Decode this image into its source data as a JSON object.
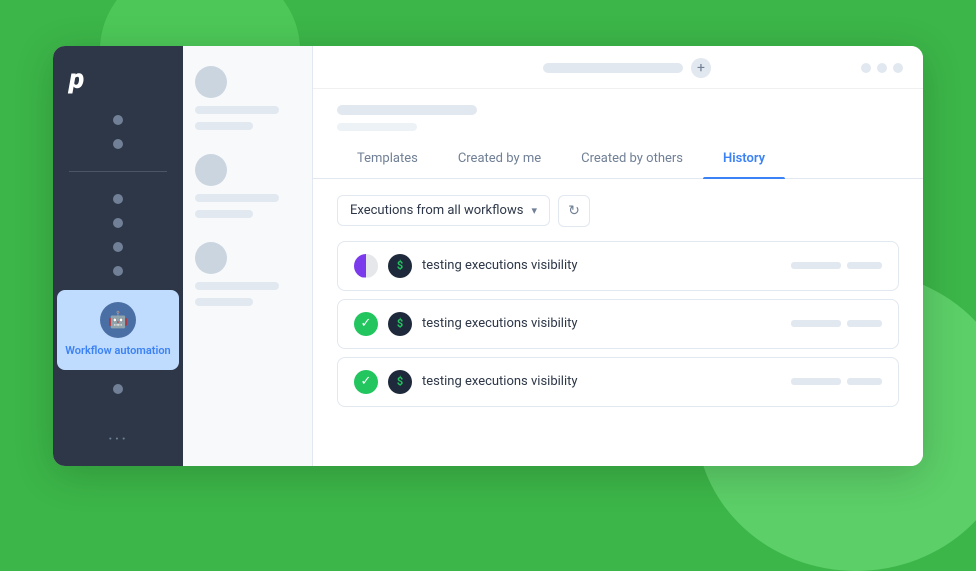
{
  "app": {
    "logo": "p",
    "window_controls": [
      "dot1",
      "dot2",
      "dot3"
    ]
  },
  "sidebar": {
    "nav_items": [
      {
        "id": "dot1",
        "active": false
      },
      {
        "id": "dot2",
        "active": false
      },
      {
        "id": "dot3",
        "active": false
      },
      {
        "id": "dot4",
        "active": false
      },
      {
        "id": "dot5",
        "active": false
      },
      {
        "id": "dot6",
        "active": false
      },
      {
        "id": "dot7",
        "active": false
      }
    ],
    "active_item": {
      "label": "Workflow\nautomation",
      "icon": "🤖"
    },
    "more_label": "···"
  },
  "tabs": [
    {
      "id": "templates",
      "label": "Templates",
      "active": false
    },
    {
      "id": "created-by-me",
      "label": "Created by me",
      "active": false
    },
    {
      "id": "created-by-others",
      "label": "Created by others",
      "active": false
    },
    {
      "id": "history",
      "label": "History",
      "active": true
    }
  ],
  "dropdown": {
    "value": "Executions from all workflows",
    "placeholder": "Executions from all workflows"
  },
  "refresh_button": {
    "icon": "↻"
  },
  "executions": [
    {
      "id": 1,
      "status": "pending",
      "name": "testing executions visibility"
    },
    {
      "id": 2,
      "status": "success",
      "name": "testing executions visibility"
    },
    {
      "id": 3,
      "status": "success",
      "name": "testing executions visibility"
    }
  ],
  "colors": {
    "accent": "#3b82f6",
    "success": "#22c55e",
    "sidebar_bg": "#2d3748",
    "active_nav_bg": "#bfdbfe"
  }
}
